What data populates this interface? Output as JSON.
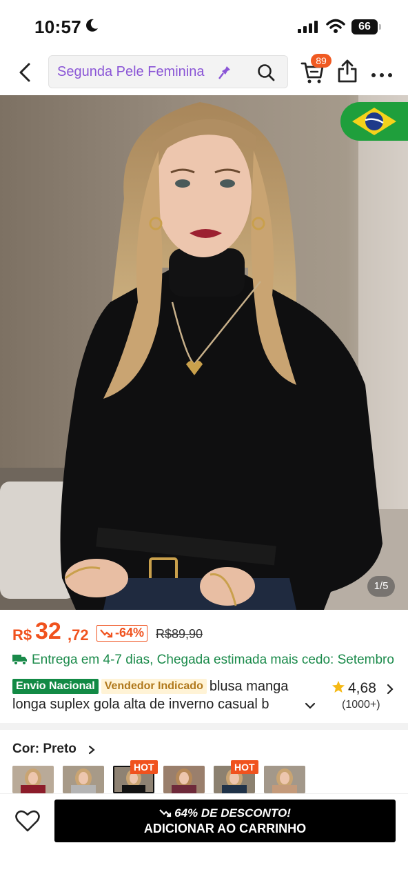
{
  "status_bar": {
    "time": "10:57",
    "battery": "66"
  },
  "header": {
    "search_text": "Segunda Pele Feminina",
    "cart_count": "89"
  },
  "gallery": {
    "counter": "1/5",
    "flag": "Brazil"
  },
  "price": {
    "currency": "R$",
    "integer": "32",
    "decimal": ",72",
    "discount": "-64%",
    "original": "R$89,90"
  },
  "delivery": "Entrega em 4-7 dias, Chegada estimada mais cedo: Setembro",
  "product": {
    "tag_national": "Envio Nacional",
    "tag_seller": "Vendedor Indicado",
    "title_line1": "blusa manga",
    "title_line2": "longa suplex gola alta de inverno casual b"
  },
  "rating": {
    "score": "4,68",
    "count": "(1000+)"
  },
  "color": {
    "label": "Cor: Preto",
    "hot_label": "HOT",
    "options": [
      {
        "color": "#8c1c2a"
      },
      {
        "color": "#b4b4b4"
      },
      {
        "color": "#121212",
        "selected": true
      },
      {
        "color": "#6e2a3a"
      },
      {
        "color": "#1f3248"
      },
      {
        "color": "#c49a7a"
      }
    ]
  },
  "cta": {
    "promo": "64% DE DESCONTO!",
    "label": "ADICIONAR AO CARRINHO"
  }
}
